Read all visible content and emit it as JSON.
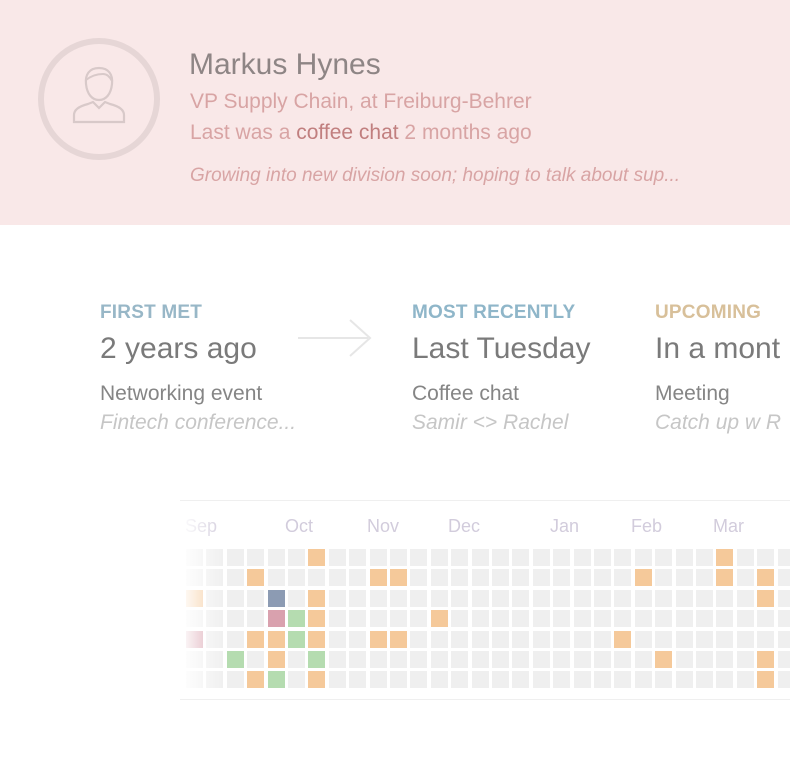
{
  "contact": {
    "name": "Markus Hynes",
    "role": "VP Supply Chain, at Freiburg-Behrer",
    "last_prefix": "Last was a ",
    "last_highlight": "coffee chat",
    "last_suffix": " 2 months ago",
    "note": "Growing into new division soon; hoping to talk about sup...",
    "avatar_icon": "person-icon"
  },
  "timeline": {
    "arrow_icon": "arrow-right-icon",
    "first_met": {
      "label": "FIRST MET",
      "when": "2 years ago",
      "type": "Networking event",
      "detail": "Fintech conference...",
      "label_color": "#98b7c7"
    },
    "most_recently": {
      "label": "MOST RECENTLY",
      "when": "Last Tuesday",
      "type": "Coffee chat",
      "detail": "Samir <> Rachel",
      "label_color": "#8fb6c9"
    },
    "upcoming": {
      "label": "UPCOMING",
      "when": "In a mont",
      "type": "Meeting",
      "detail": "Catch up w R",
      "label_color": "#d8c09a"
    }
  },
  "heatmap": {
    "months": [
      "Sep",
      "Oct",
      "Nov",
      "Dec",
      "Jan",
      "Feb",
      "Mar"
    ],
    "colors": {
      "o": "#f5c99a",
      "g": "#b5dcb0",
      "b": "#8c9bb3",
      "p": "#d9a1ae",
      "e": "#efefef"
    },
    "rows": [
      "eeeeeeoeeeeeeeeeeeeeeeeeeeoeeee",
      "eeeoeeeeeooeeeeeeeeeeeoeeeoeoee",
      "oeeebeoeeeeeeeeeeeeeeeeeeeeeoee",
      "eeeepgoeeeeeoeeeeeeeeeeeeeeeeee",
      "peeoogoeeooeeeeeeeeeeoeeeeeeeee",
      "eegeoegeeeeeeeeeeeeeeeeoeeeeoee",
      "eeeogeoeeeeeeeeeeeeeeeeeeeeeoee"
    ]
  }
}
